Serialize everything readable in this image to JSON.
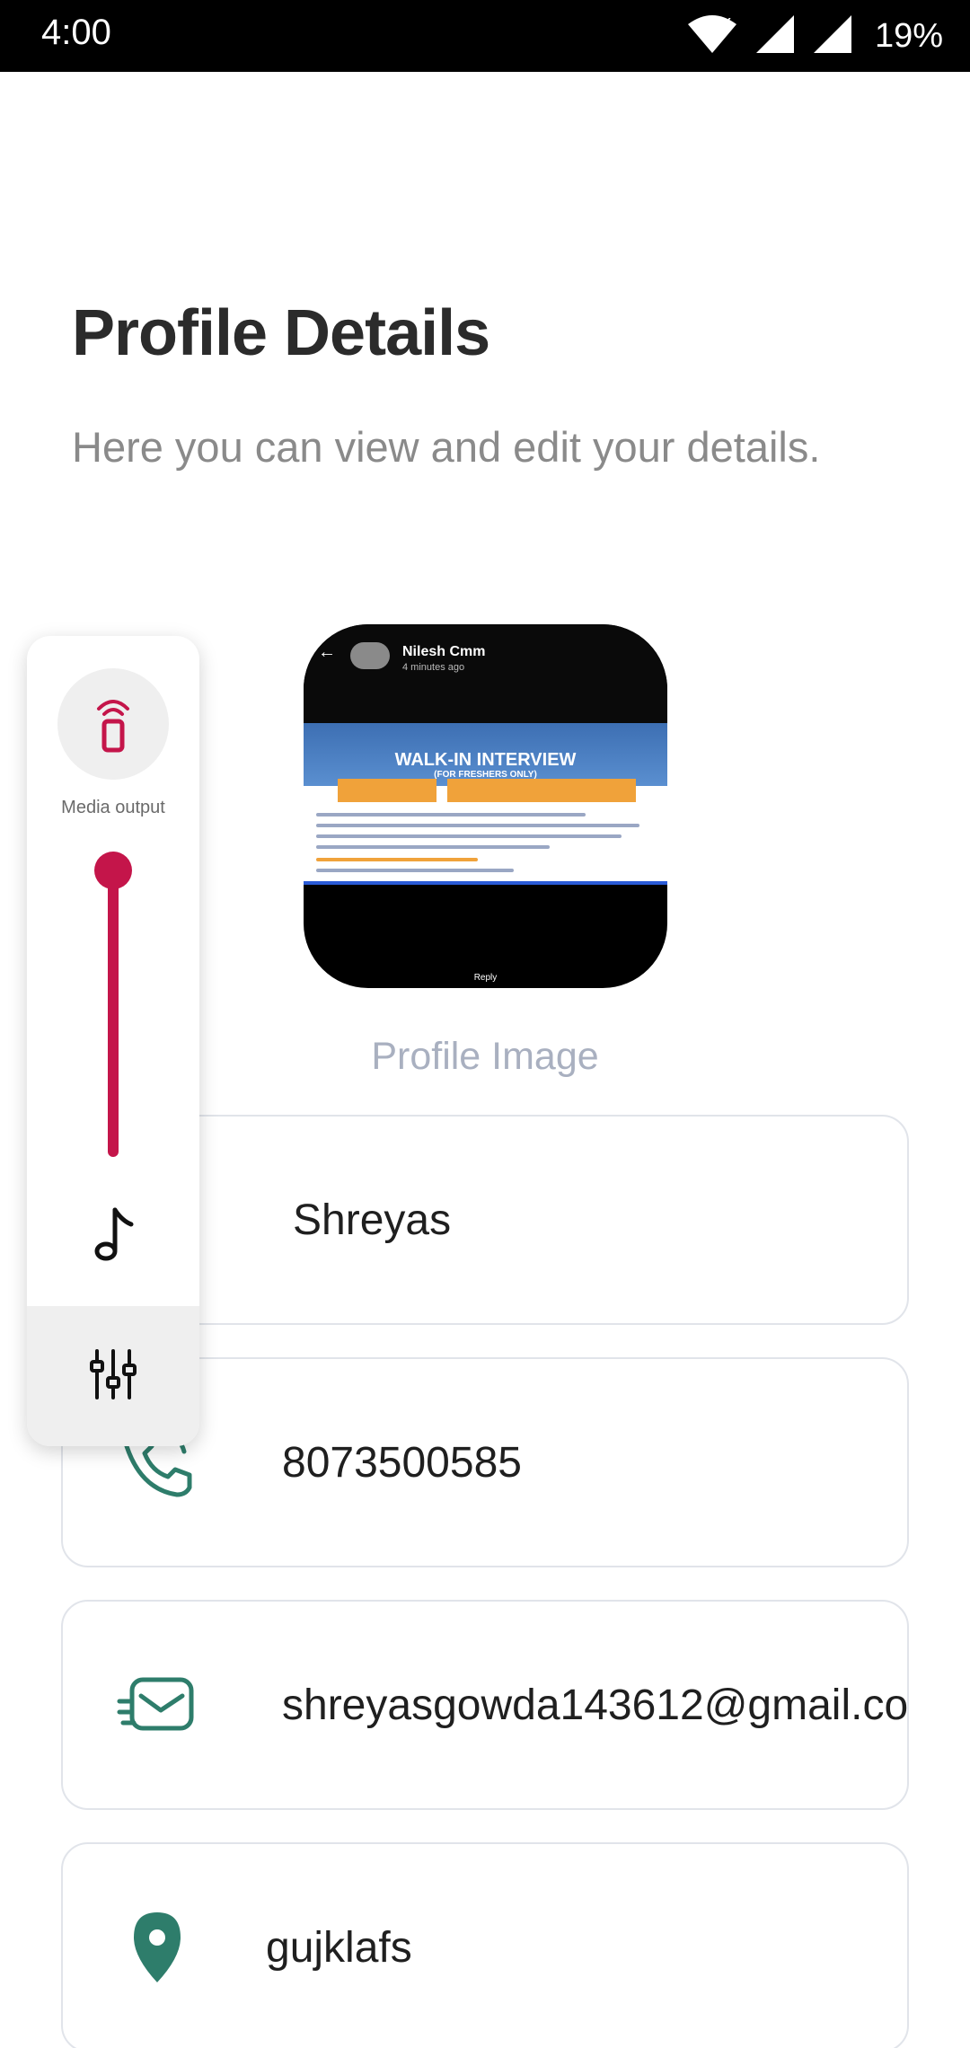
{
  "status_bar": {
    "time": "4:00",
    "battery": "19%",
    "icons": [
      "wifi-icon",
      "cellular-icon",
      "cellular-icon",
      "battery-text"
    ]
  },
  "header": {
    "title": "Profile Details",
    "subtitle": "Here you can view and edit your details."
  },
  "profile": {
    "image_caption": "Profile Image",
    "thumbnail": {
      "chat_name": "Nilesh Cmm",
      "chat_sub": "4 minutes ago",
      "headline": "WALK-IN INTERVIEW",
      "subheadline": "(FOR FRESHERS ONLY)",
      "reply_label": "Reply"
    }
  },
  "fields": {
    "name": "Shreyas",
    "phone": "8073500585",
    "email": "shreyasgowda143612@gmail.co",
    "location": "gujklafs"
  },
  "volume_panel": {
    "media_output_label": "Media output",
    "volume_level": 1.0
  },
  "colors": {
    "accent_icon": "#2e7d6b",
    "volume_accent": "#c4154a",
    "caption": "#a9b0c0"
  }
}
